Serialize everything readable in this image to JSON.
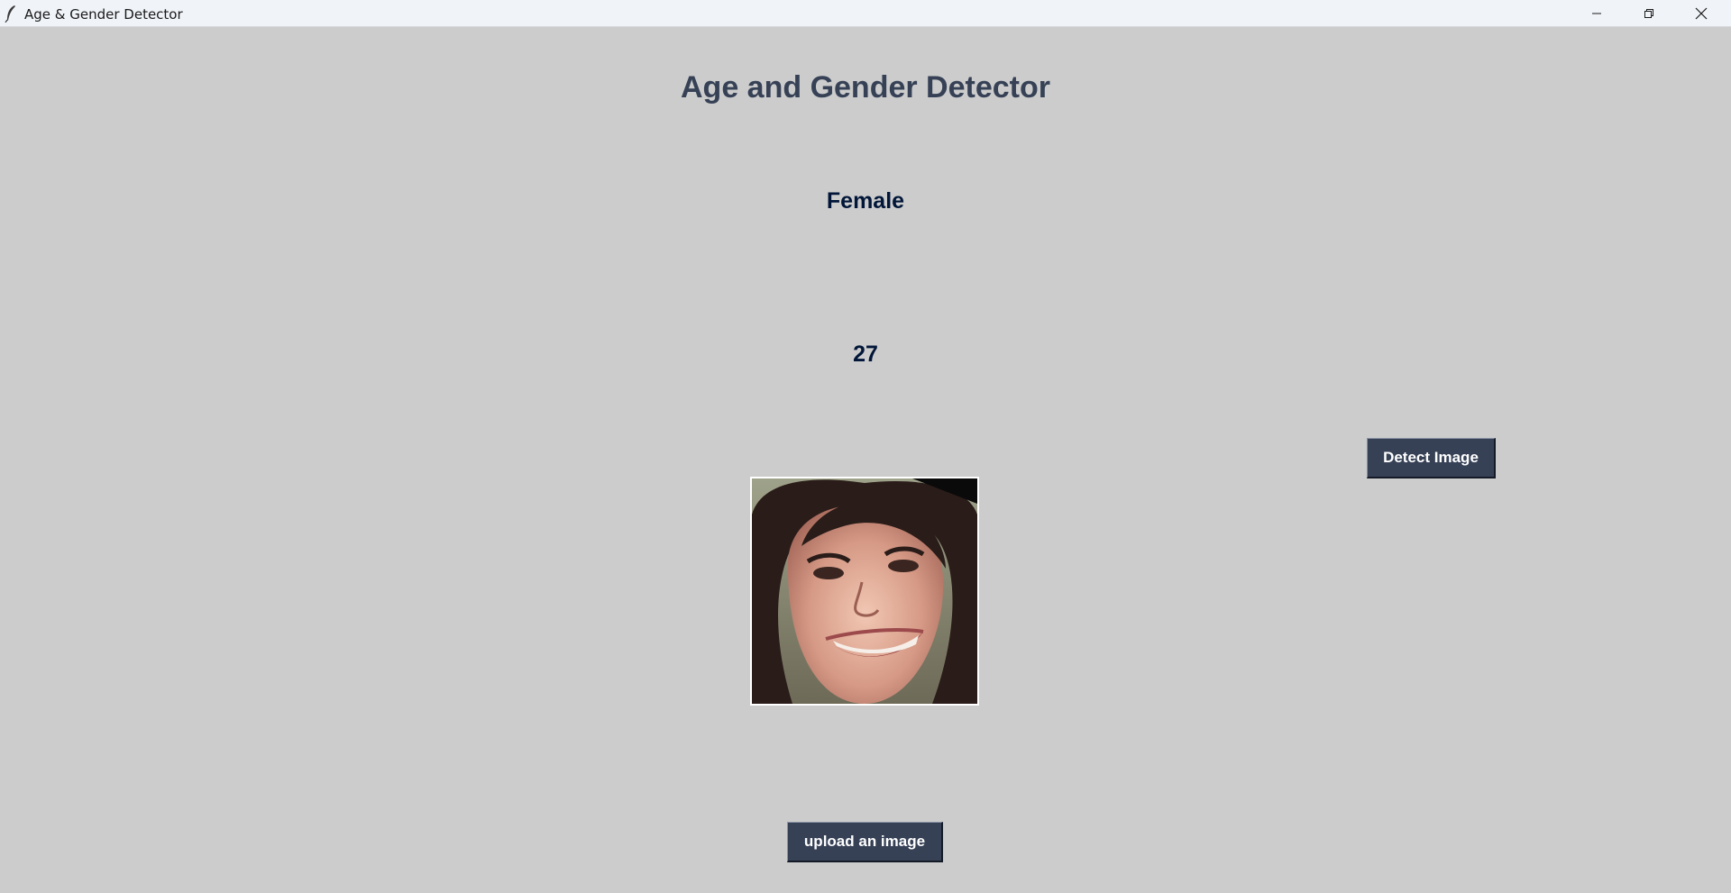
{
  "window": {
    "title": "Age & Gender Detector",
    "controls": [
      "minimize",
      "restore",
      "close"
    ]
  },
  "app": {
    "heading": "Age and Gender Detector",
    "gender_result": "Female",
    "age_result": "27",
    "detect_button_label": "Detect Image",
    "upload_button_label": "upload an image"
  },
  "colors": {
    "background": "#cccccc",
    "heading": "#364156",
    "result_text": "#011638",
    "button_bg": "#364156",
    "button_text": "#ffffff"
  },
  "icons": {
    "app": "feather-icon",
    "minimize": "minimize-icon",
    "restore": "restore-icon",
    "close": "close-icon"
  }
}
